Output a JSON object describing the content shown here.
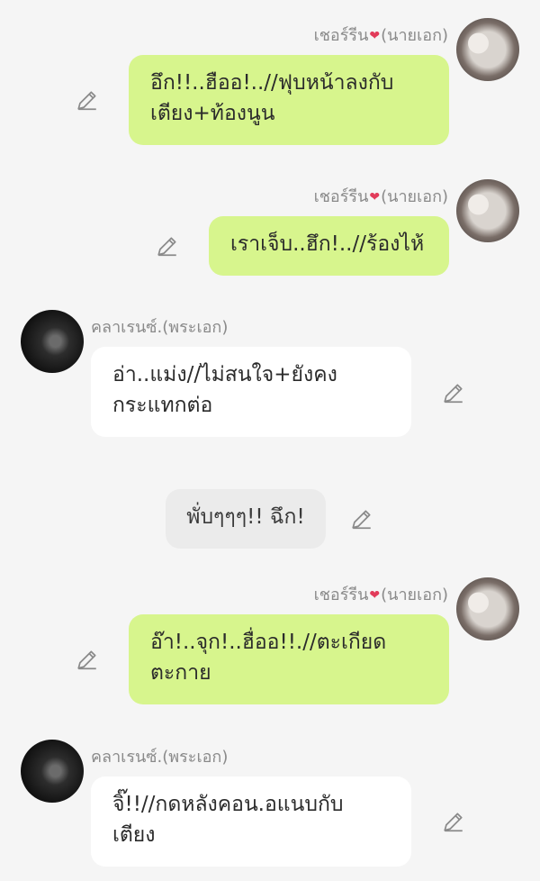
{
  "messages": [
    {
      "sender": "เชอร์รีน",
      "role": "(นายเอก)",
      "lines": [
        "อึก!!..ฮืออ!..//ฟุบหน้าลงกับ",
        "เตียง+ท้องนูน"
      ]
    },
    {
      "sender": "เชอร์รีน",
      "role": "(นายเอก)",
      "lines": [
        "เราเจ็บ..ฮึก!..//ร้องไห้"
      ]
    },
    {
      "sender": "คลาเรนซ์.",
      "role": "(พระเอก)",
      "lines": [
        "อ่า..แม่ง//ไม่สนใจ+ยังคง",
        "กระแทกต่อ"
      ]
    },
    {
      "narration": "พั่บๆๆๆ!! ฉึก!"
    },
    {
      "sender": "เชอร์รีน",
      "role": "(นายเอก)",
      "lines": [
        "อ๊า!..จุก!..ฮื่ออ!!.//ตะเกียด",
        "ตะกาย"
      ]
    },
    {
      "sender": "คลาเรนซ์.",
      "role": "(พระเอก)",
      "lines": [
        "จิ๊!!//กดหลังคอน.อแนบกับ",
        "เตียง"
      ]
    }
  ],
  "icons": {
    "edit": "pencil-icon",
    "heart": "heart-icon"
  },
  "colors": {
    "green_bubble": "#d7f58d",
    "white_bubble": "#ffffff",
    "narration_bubble": "#ebebeb",
    "background": "#f5f5f5"
  }
}
